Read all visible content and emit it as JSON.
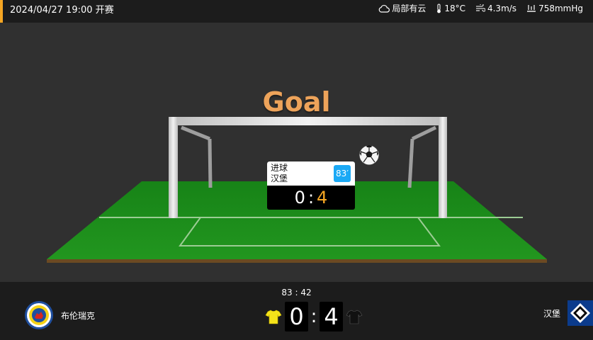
{
  "topbar": {
    "datetime": "2024/04/27 19:00 开赛",
    "weather": {
      "condition": "局部有云",
      "temperature": "18°C",
      "wind": "4.3m/s",
      "pressure": "758mmHg"
    }
  },
  "stage": {
    "title": "Goal",
    "popup": {
      "event_type": "进球",
      "team": "汉堡",
      "minute": "83′",
      "score_home": "0",
      "score_separator": ":",
      "score_away": "4"
    }
  },
  "match": {
    "clock": "83 : 42",
    "home_team": "布伦瑞克",
    "away_team": "汉堡",
    "score_home": "0",
    "score_separator": ":",
    "score_away": "4",
    "home_jersey_color": "#f5e31a",
    "away_jersey_color": "#111111"
  },
  "icons": {
    "weather": "cloud-icon",
    "temperature": "thermometer-icon",
    "wind": "wind-icon",
    "pressure": "pressure-icon",
    "ball": "soccer-ball-icon"
  },
  "colors": {
    "accent": "#f5a623",
    "minute_badge": "#1ba9f5",
    "goal_title": "#eda35a",
    "grass": "#1c8a1c"
  }
}
